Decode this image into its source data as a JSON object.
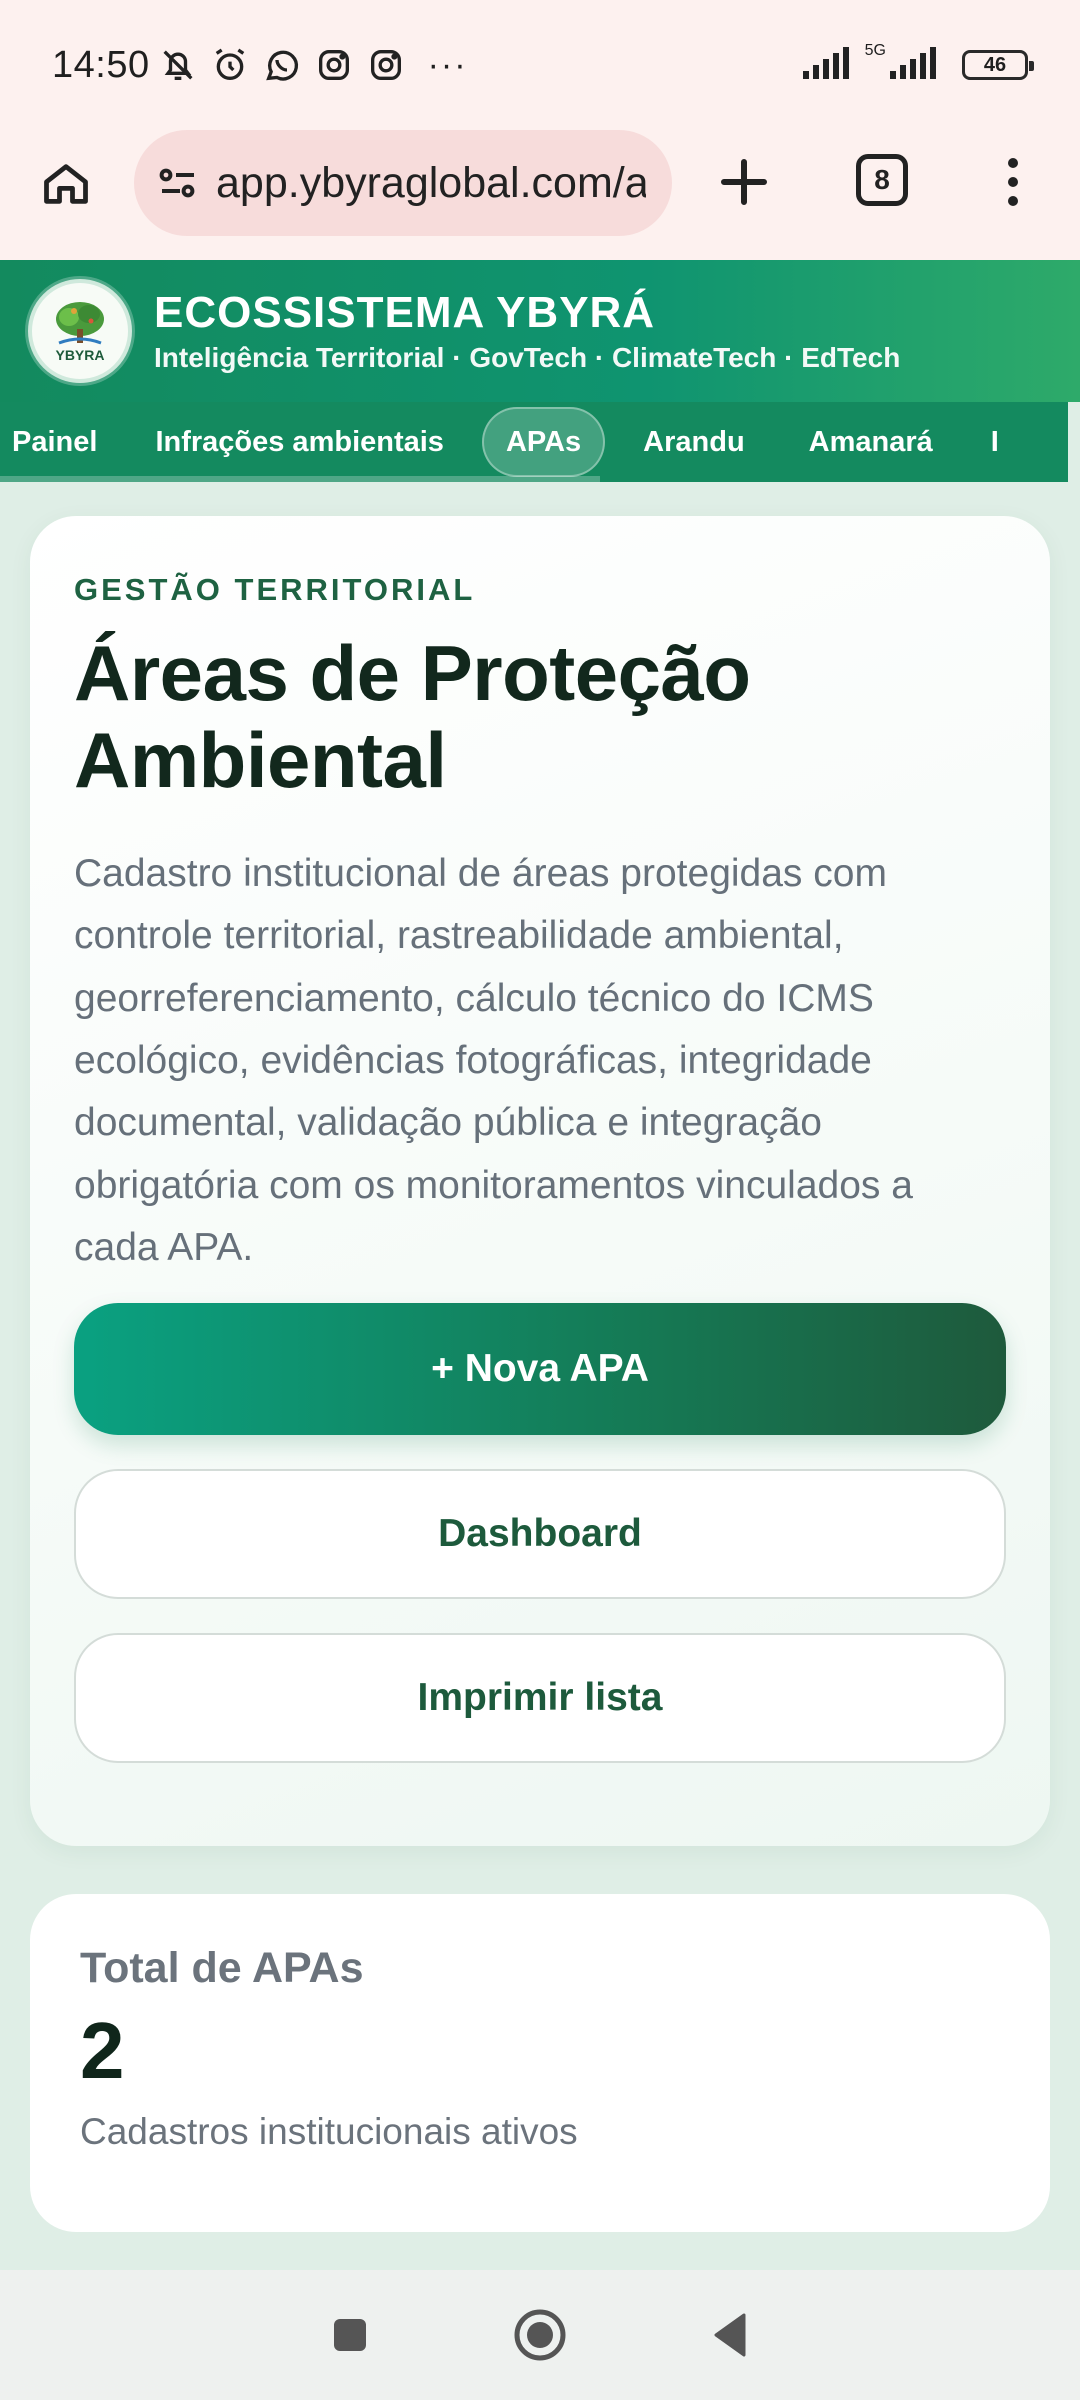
{
  "status_bar": {
    "time": "14:50",
    "network": "5G",
    "battery": "46"
  },
  "browser": {
    "url": "app.ybyraglobal.com/a",
    "tab_count": "8"
  },
  "app": {
    "logo_text": "YBYRA",
    "title": "ECOSSISTEMA YBYRÁ",
    "subtitle": "Inteligência Territorial · GovTech · ClimateTech · EdTech"
  },
  "nav": {
    "tabs": [
      {
        "label": "Painel"
      },
      {
        "label": "Infrações ambientais"
      },
      {
        "label": "APAs"
      },
      {
        "label": "Arandu"
      },
      {
        "label": "Amanará"
      },
      {
        "label": "I"
      }
    ],
    "active_tab": "APAs"
  },
  "main": {
    "eyebrow": "GESTÃO TERRITORIAL",
    "title": "Áreas de Proteção Ambiental",
    "description": "Cadastro institucional de áreas protegidas com controle territorial, rastreabilidade ambiental, georreferenciamento, cálculo técnico do ICMS ecológico, evidências fotográficas, integridade documental, validação pública e integração obrigatória com os monitoramentos vinculados a cada APA.",
    "new_button": "+ Nova APA",
    "dashboard_button": "Dashboard",
    "print_button": "Imprimir lista"
  },
  "stats": {
    "label": "Total de APAs",
    "value": "2",
    "sub": "Cadastros institucionais ativos"
  },
  "colors": {
    "primary": "#138a5e",
    "dark_text": "#12281d",
    "accent_text": "#1e6242"
  }
}
